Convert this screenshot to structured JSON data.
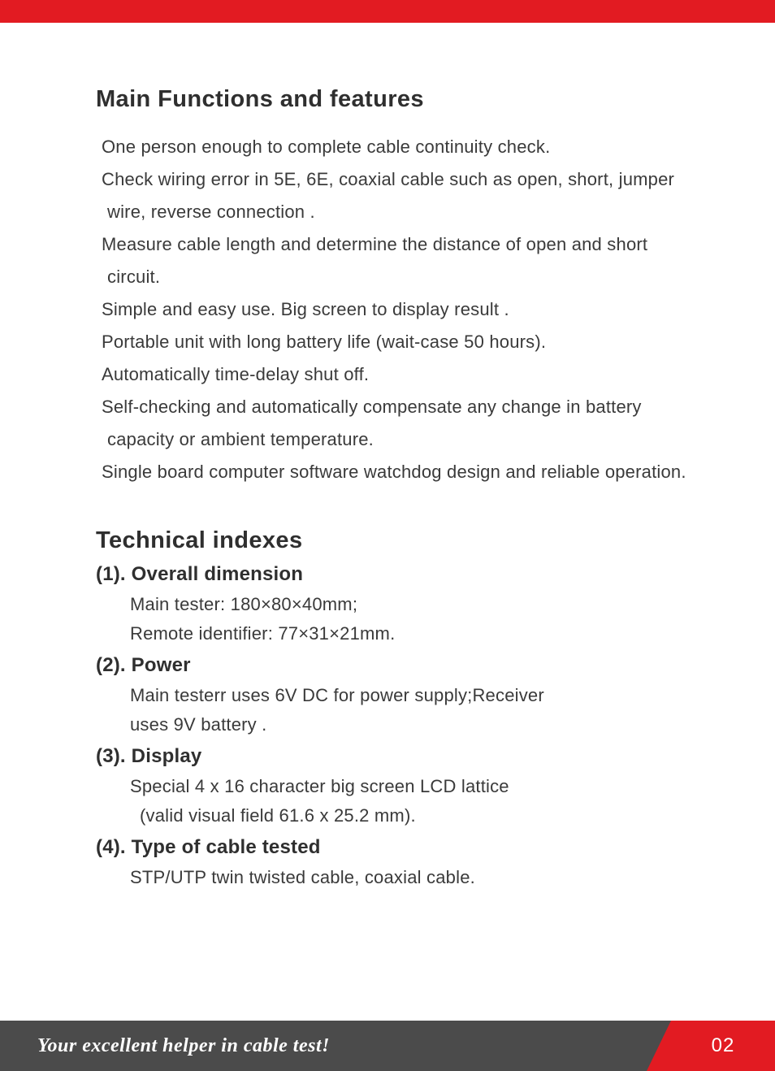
{
  "headings": {
    "main_functions": "Main Functions and features",
    "technical_indexes": "Technical indexes"
  },
  "features": [
    " One person enough to complete cable continuity check.",
    " Check wiring error in 5E, 6E, coaxial cable such as open, short, jumper wire, reverse connection .",
    " Measure cable length and determine the distance of open and short circuit.",
    " Simple and easy use. Big screen to display result .",
    " Portable unit with long battery life (wait-case 50 hours).",
    " Automatically time-delay shut off.",
    " Self-checking  and automatically compensate any change in battery capacity or ambient temperature.",
    " Single board computer software watchdog design and reliable operation."
  ],
  "technical": {
    "item1": {
      "label": "(1). Overall dimension",
      "line1": " Main tester: 180×80×40mm;",
      "line2": "Remote identifier: 77×31×21mm."
    },
    "item2": {
      "label": "(2). Power",
      "line1": " Main testerr uses 6V DC  for power supply;Receiver",
      "line2": "uses 9V battery ."
    },
    "item3": {
      "label": "(3). Display",
      "line1": "Special 4 x 16 character big screen LCD lattice",
      "line2": " (valid visual field 61.6 x 25.2 mm)."
    },
    "item4": {
      "label": "(4). Type of cable tested",
      "line1": " STP/UTP twin twisted cable, coaxial cable."
    }
  },
  "footer": {
    "tagline": "Your excellent helper in cable test!",
    "page_number": "02"
  }
}
